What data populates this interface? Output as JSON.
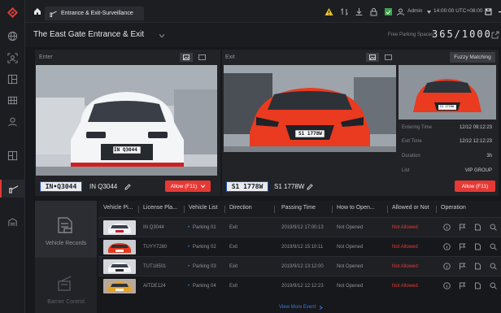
{
  "topbar": {
    "tab_label": "Entrance & Exit-Surveillance",
    "user": "Admin",
    "time": "14:00:00 UTC+08:00"
  },
  "header": {
    "title": "The East Gate Entrance & Exit",
    "free_parking_label": "Free Parking Spaces",
    "free_parking_value": "365/1000"
  },
  "enter": {
    "label": "Enter",
    "plate": "IN•Q3044",
    "plate_text": "IN Q3044",
    "allow_btn": "Allow (F11)"
  },
  "exit": {
    "label": "Exit",
    "plate": "S1 1778W",
    "plate_text": "S1 1778W",
    "fuzzy_btn": "Fuzzy Matching",
    "allow_btn": "Allow (F11)",
    "info": [
      {
        "label": "Entering Time",
        "value": "12/12 09:12:23"
      },
      {
        "label": "Exit Time",
        "value": "12/12 12:12:23"
      },
      {
        "label": "Duration",
        "value": "3h"
      },
      {
        "label": "List",
        "value": "VIP GROUP"
      }
    ],
    "thumb_plate": "S1 1778W"
  },
  "nav": {
    "records": "Vehicle Records",
    "barrier": "Barrier Control"
  },
  "table": {
    "headers": [
      "Vehicle Pi...",
      "License Pla...",
      "Vehicle List",
      "Direction",
      "Passing Time",
      "How to Open...",
      "Allowed or Not",
      "Operation"
    ],
    "rows": [
      {
        "plate": "IN Q3044",
        "list": "Parking 01",
        "dir": "Exit",
        "time": "2019/9/12 17:00:13",
        "open": "Not Opened",
        "allowed": "Not Allowed"
      },
      {
        "plate": "TUYY7280",
        "list": "Parking 02",
        "dir": "Exit",
        "time": "2019/9/12 15:10:11",
        "open": "Not Opened",
        "allowed": "Not Allowed"
      },
      {
        "plate": "TUT18501",
        "list": "Parking 03",
        "dir": "Exit",
        "time": "2019/9/12 13:12:00",
        "open": "Not Opened",
        "allowed": "Not Allowed"
      },
      {
        "plate": "AITDE124",
        "list": "Parking 04",
        "dir": "Exit",
        "time": "2019/9/12 12:12:23",
        "open": "Not Opened",
        "allowed": "Not Allowed"
      }
    ],
    "more": "View More Event"
  },
  "colors": {
    "accent": "#e53935",
    "list_dot": "#2f7de1",
    "background": "#17181b"
  }
}
